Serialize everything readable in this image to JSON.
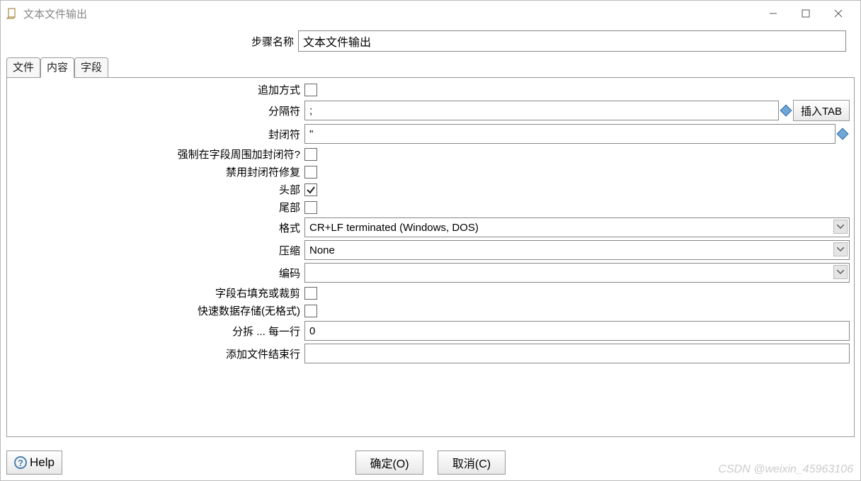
{
  "window": {
    "title": "文本文件输出"
  },
  "step": {
    "label": "步骤名称",
    "value": "文本文件输出"
  },
  "tabs": {
    "file": "文件",
    "content": "内容",
    "fields": "字段"
  },
  "form": {
    "append": {
      "label": "追加方式",
      "checked": false
    },
    "separator": {
      "label": "分隔符",
      "value": ";",
      "insert_tab_btn": "插入TAB"
    },
    "enclosure": {
      "label": "封闭符",
      "value": "\""
    },
    "force_enclose": {
      "label": "强制在字段周围加封闭符?",
      "checked": false
    },
    "disable_enclosure_fix": {
      "label": "禁用封闭符修复",
      "checked": false
    },
    "header": {
      "label": "头部",
      "checked": true
    },
    "footer": {
      "label": "尾部",
      "checked": false
    },
    "format": {
      "label": "格式",
      "value": "CR+LF terminated (Windows, DOS)"
    },
    "compression": {
      "label": "压缩",
      "value": "None"
    },
    "encoding": {
      "label": "编码",
      "value": ""
    },
    "right_pad_trim": {
      "label": "字段右填充或裁剪",
      "checked": false
    },
    "fast_dump": {
      "label": "快速数据存储(无格式)",
      "checked": false
    },
    "split": {
      "label": "分拆 ... 每一行",
      "value": "0"
    },
    "end_line": {
      "label": "添加文件结束行",
      "value": ""
    }
  },
  "buttons": {
    "help": "Help",
    "ok": "确定(O)",
    "cancel": "取消(C)"
  },
  "watermark": "CSDN @weixin_45963106"
}
